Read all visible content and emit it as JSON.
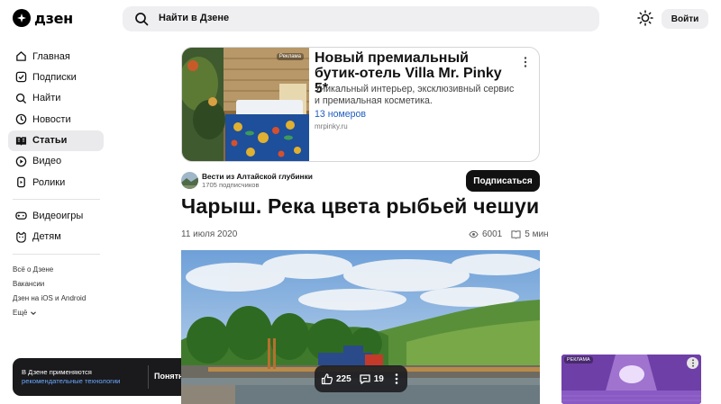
{
  "header": {
    "logo_text": "дзен",
    "search_placeholder": "Найти в Дзене",
    "login_label": "Войти"
  },
  "sidebar": {
    "items": [
      {
        "label": "Главная",
        "icon": "home-icon"
      },
      {
        "label": "Подписки",
        "icon": "subscriptions-icon"
      },
      {
        "label": "Найти",
        "icon": "search-icon"
      },
      {
        "label": "Новости",
        "icon": "news-icon"
      },
      {
        "label": "Статьи",
        "icon": "articles-icon",
        "active": true
      },
      {
        "label": "Видео",
        "icon": "video-icon"
      },
      {
        "label": "Ролики",
        "icon": "shorts-icon"
      }
    ],
    "secondary_items": [
      {
        "label": "Видеоигры",
        "icon": "gamepad-icon"
      },
      {
        "label": "Детям",
        "icon": "kids-icon"
      }
    ],
    "footer_links": [
      "Всё о Дзене",
      "Вакансии",
      "Дзен на iOS и Android"
    ],
    "more_label": "Ещё"
  },
  "cookie": {
    "line1": "В Дзене применяются",
    "link": "рекомендательные технологии",
    "button": "Понятно"
  },
  "ad": {
    "badge": "Реклама",
    "title": "Новый премиальный бутик-отель Villa Mr. Pinky 5*",
    "description": "Уникальный интерьер, эксклюзивный сервис и премиальная косметика.",
    "link": "13 номеров",
    "domain": "mrpinky.ru"
  },
  "channel": {
    "name": "Вести из Алтайской глубинки",
    "subscribers": "1705 подписчиков",
    "subscribe_label": "Подписаться"
  },
  "article": {
    "title": "Чарыш. Река цвета рыбьей чешуи",
    "date": "11 июля 2020",
    "views": "6001",
    "read_time": "5 мин"
  },
  "reactions": {
    "likes": "225",
    "comments": "19"
  },
  "right_ad": {
    "badge": "РЕКЛАМА"
  }
}
